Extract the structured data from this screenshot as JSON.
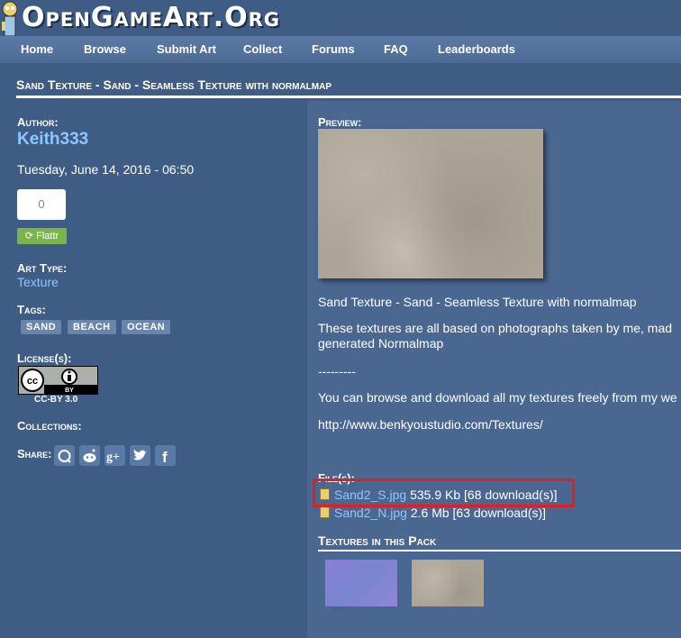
{
  "site": {
    "logo_text": "OpenGameArt.Org"
  },
  "nav": [
    "Home",
    "Browse",
    "Submit Art",
    "Collect",
    "Forums",
    "FAQ",
    "Leaderboards"
  ],
  "page_title": "Sand Texture - Sand - Seamless Texture with normalmap",
  "sidebar": {
    "author_label": "Author:",
    "author": "Keith333",
    "date": "Tuesday, June 14, 2016 - 06:50",
    "flattr_count": "0",
    "flattr_label": "Flattr",
    "art_type_label": "Art Type:",
    "art_type": "Texture",
    "tags_label": "Tags:",
    "tags": [
      "SAND",
      "BEACH",
      "OCEAN"
    ],
    "license_label": "License(s):",
    "license": "CC-BY 3.0",
    "collections_label": "Collections:",
    "share_label": "Share:",
    "share_icons": [
      "reddit-icon",
      "digg-icon",
      "google-plus-icon",
      "twitter-icon",
      "facebook-icon"
    ]
  },
  "main": {
    "preview_label": "Preview:",
    "description_1": "Sand Texture - Sand - Seamless Texture with normalmap",
    "description_2a": "These textures are all based on photographs taken by me, mad",
    "description_2b": "generated Normalmap",
    "separator": "---------",
    "description_3": "You can browse and download all my textures freely from my we",
    "website_link": "http://www.benkyoustudio.com/Textures/",
    "files_label": "File(s):",
    "files": [
      {
        "name": "Sand2_S.jpg",
        "meta": "535.9 Kb [68 download(s)]"
      },
      {
        "name": "Sand2_N.jpg",
        "meta": "2.6 Mb [63 download(s)]"
      }
    ],
    "pack_label": "Textures in this Pack"
  },
  "colors": {
    "background": "#3f5c85",
    "link": "#8ec6ff",
    "highlight": "#e0201f"
  }
}
